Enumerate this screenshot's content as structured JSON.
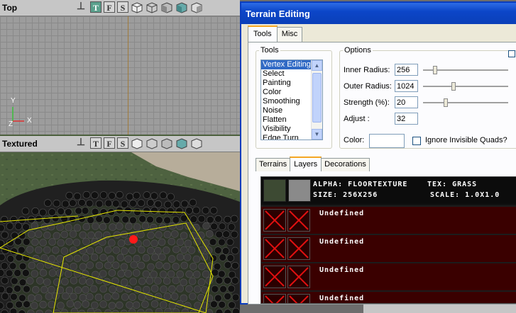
{
  "viewports": {
    "top": {
      "title": "Top",
      "tools": [
        "T",
        "F",
        "S"
      ],
      "axes": {
        "x": "X",
        "y": "Y",
        "z": "Z"
      }
    },
    "textured": {
      "title": "Textured",
      "tools": [
        "T",
        "F",
        "S"
      ]
    }
  },
  "terrain_window": {
    "title": "Terrain Editing",
    "tabs": [
      "Tools",
      "Misc"
    ],
    "active_tab": "Tools",
    "tools_group": {
      "legend": "Tools",
      "items": [
        "Vertex Editing",
        "Select",
        "Painting",
        "Color",
        "Smoothing",
        "Noise",
        "Flatten",
        "Visibility",
        "Edge Turn"
      ],
      "selected": "Vertex Editing"
    },
    "options_group": {
      "legend": "Options",
      "inner_radius": {
        "label": "Inner Radius:",
        "value": "256",
        "slider_fraction": 0.12
      },
      "outer_radius": {
        "label": "Outer Radius:",
        "value": "1024",
        "slider_fraction": 0.35
      },
      "strength": {
        "label": "Strength (%):",
        "value": "20",
        "slider_fraction": 0.25
      },
      "adjust": {
        "label": "Adjust :",
        "value": "32"
      },
      "color_label": "Color:",
      "color_value": "#ffffff",
      "ignore_invisible_label": "Ignore Invisible Quads?",
      "ignore_invisible_checked": false
    },
    "subtabs": [
      "Terrains",
      "Layers",
      "Decorations"
    ],
    "active_subtab": "Layers",
    "layers": {
      "first": {
        "alpha_line": "ALPHA: FLOORTEXTURE",
        "tex_line": "TEX: GRASS",
        "size_line": "SIZE: 256X256",
        "scale_line": "SCALE: 1.0X1.0"
      },
      "undefined": [
        "Undefined",
        "Undefined",
        "Undefined",
        "Undefined"
      ]
    }
  },
  "colors": {
    "titlebar": "#0c46c8",
    "selection": "#316ac5",
    "layer_undefined_bg": "#3a0000",
    "marker": "#ff0000",
    "selection_outline": "#e6e600"
  }
}
